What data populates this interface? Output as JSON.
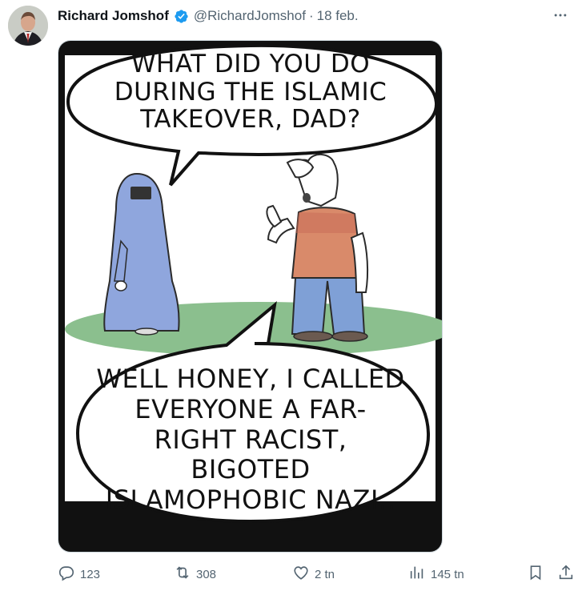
{
  "author": {
    "name": "Richard Jomshof",
    "handle": "@RichardJomshof",
    "separator": "·",
    "date": "18 feb."
  },
  "comic": {
    "top_bubble": "WHAT DID YOU DO DURING THE ISLAMIC TAKEOVER, DAD?",
    "bottom_bubble": "WELL HONEY, I CALLED EVERYONE A FAR-RIGHT RACIST, BIGOTED ISLAMOPHOBIC NAZI.."
  },
  "actions": {
    "replies": "123",
    "reposts": "308",
    "likes": "2 tn",
    "views": "145 tn"
  },
  "colors": {
    "verified": "#1d9bf0",
    "muted": "#536471",
    "burqa": "#8fa6dd",
    "grass": "#8bbf8e"
  },
  "icons": [
    "verified-badge-icon",
    "more-icon",
    "reply-icon",
    "repost-icon",
    "like-icon",
    "views-icon",
    "bookmark-icon",
    "share-icon"
  ]
}
